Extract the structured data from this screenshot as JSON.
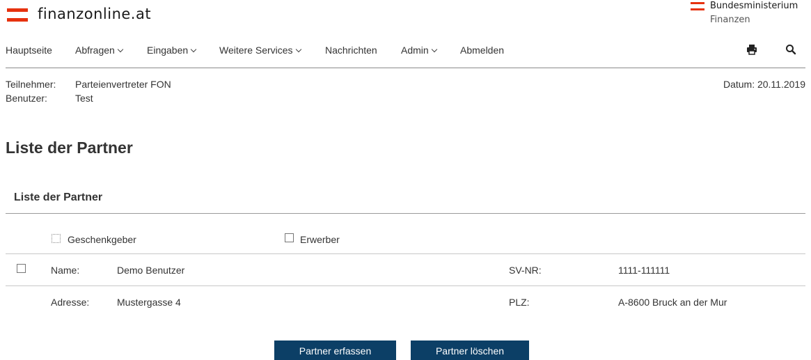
{
  "header": {
    "logo_text": "finanzonline.at",
    "ministry_line1": "Bundesministerium",
    "ministry_line2": "Finanzen"
  },
  "nav": {
    "items": [
      {
        "label": "Hauptseite",
        "has_dropdown": false
      },
      {
        "label": "Abfragen",
        "has_dropdown": true
      },
      {
        "label": "Eingaben",
        "has_dropdown": true
      },
      {
        "label": "Weitere Services",
        "has_dropdown": true
      },
      {
        "label": "Nachrichten",
        "has_dropdown": false
      },
      {
        "label": "Admin",
        "has_dropdown": true
      },
      {
        "label": "Abmelden",
        "has_dropdown": false
      }
    ],
    "print_icon": "print-icon",
    "search_icon": "search-icon"
  },
  "info": {
    "teilnehmer_label": "Teilnehmer:",
    "teilnehmer_value": "Parteienvertreter FON",
    "benutzer_label": "Benutzer:",
    "benutzer_value": "Test",
    "datum": "Datum: 20.11.2019"
  },
  "page_title": "Liste der Partner",
  "section": {
    "title": "Liste der Partner",
    "filters": {
      "geschenkgeber": "Geschenkgeber",
      "erwerber": "Erwerber"
    },
    "partner": {
      "name_label": "Name:",
      "name_value": "Demo Benutzer",
      "svnr_label": "SV-NR:",
      "svnr_value": "1111-111111",
      "adresse_label": "Adresse:",
      "adresse_value": "Mustergasse 4",
      "plz_label": "PLZ:",
      "plz_value": "A-8600 Bruck an der Mur"
    }
  },
  "buttons": {
    "erfassen": "Partner erfassen",
    "loeschen": "Partner löschen"
  },
  "colors": {
    "brand_red": "#e6320f",
    "button_blue": "#0c3f66",
    "text": "#333333"
  }
}
